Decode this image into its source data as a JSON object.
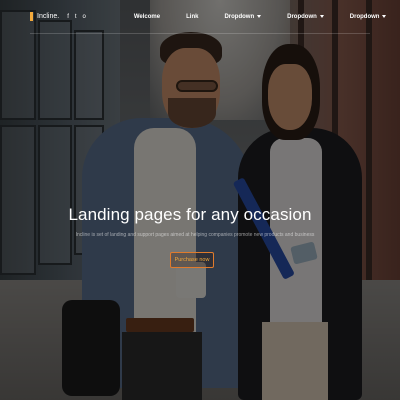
{
  "navbar": {
    "brand": "Incline.",
    "social_icons": [
      "facebook-icon",
      "twitter-icon",
      "instagram-icon"
    ],
    "social_glyphs": [
      "f",
      "t",
      "o"
    ],
    "links": [
      {
        "label": "Welcome",
        "has_caret": false
      },
      {
        "label": "Link",
        "has_caret": false
      },
      {
        "label": "Dropdown",
        "has_caret": true
      },
      {
        "label": "Dropdown",
        "has_caret": true
      },
      {
        "label": "Dropdown",
        "has_caret": true
      }
    ]
  },
  "hero": {
    "title": "Landing pages for any occasion",
    "subtitle": "Incline is set of landing and support pages aimed at helping companies promote new products and business",
    "cta_label": "Purchase now"
  },
  "colors": {
    "accent": "#f2a93b",
    "cta_border": "#e07b2c",
    "text": "#ffffff"
  }
}
